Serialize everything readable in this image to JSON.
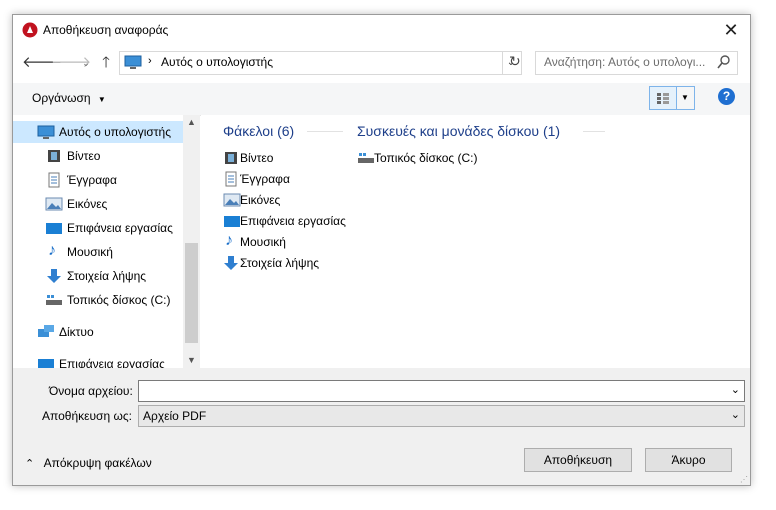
{
  "window": {
    "title": "Αποθήκευση αναφοράς",
    "close": "✕"
  },
  "address": {
    "path": "Αυτός ο υπολογιστής",
    "search_placeholder": "Αναζήτηση: Αυτός ο υπολογι..."
  },
  "toolbar": {
    "organize": "Οργάνωση",
    "help": "?"
  },
  "sidebar": {
    "items": [
      {
        "label": "Αυτός ο υπολογιστής",
        "icon": "computer-icon"
      },
      {
        "label": "Βίντεο",
        "icon": "video-icon"
      },
      {
        "label": "Έγγραφα",
        "icon": "documents-icon"
      },
      {
        "label": "Εικόνες",
        "icon": "pictures-icon"
      },
      {
        "label": "Επιφάνεια εργασίας",
        "icon": "desktop-icon"
      },
      {
        "label": "Μουσική",
        "icon": "music-icon"
      },
      {
        "label": "Στοιχεία λήψης",
        "icon": "downloads-icon"
      },
      {
        "label": "Τοπικός δίσκος (C:)",
        "icon": "drive-icon"
      },
      {
        "label": "Δίκτυο",
        "icon": "network-icon"
      },
      {
        "label": "Επιφάνεια εργασίας",
        "icon": "desktop-icon"
      }
    ]
  },
  "main": {
    "folders_header": "Φάκελοι (6)",
    "devices_header": "Συσκευές και μονάδες δίσκου (1)",
    "folders": [
      "Βίντεο",
      "Έγγραφα",
      "Εικόνες",
      "Επιφάνεια εργασίας",
      "Μουσική",
      "Στοιχεία λήψης"
    ],
    "devices": [
      "Τοπικός δίσκος (C:)"
    ]
  },
  "form": {
    "filename_label": "Όνομα αρχείου:",
    "filename_value": "",
    "savetype_label": "Αποθήκευση ως:",
    "savetype_value": "Αρχείο PDF"
  },
  "footer": {
    "hide_folders": "Απόκρυψη φακέλων",
    "save": "Αποθήκευση",
    "cancel": "Άκυρο"
  },
  "colors": {
    "accent": "#1e3f8a",
    "selected_bg": "#cce8ff",
    "help": "#1f6fd1"
  }
}
